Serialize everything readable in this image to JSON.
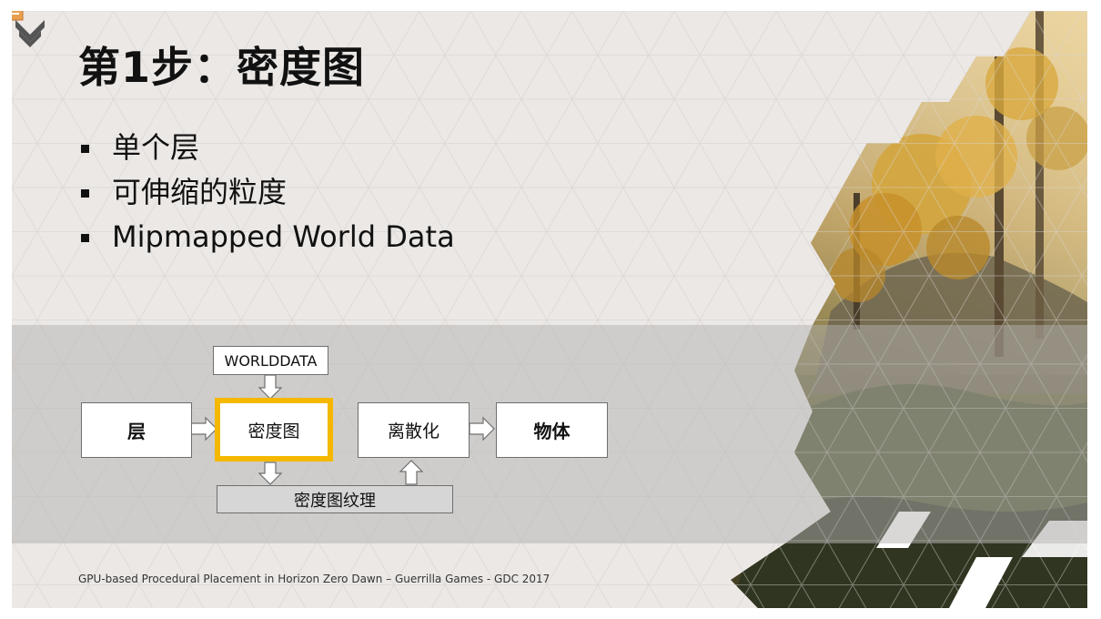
{
  "slide": {
    "title": "第1步：密度图",
    "bullets": [
      "单个层",
      "可伸缩的粒度",
      "Mipmapped World Data"
    ],
    "footer": "GPU-based Procedural Placement in Horizon Zero Dawn – Guerrilla Games - GDC 2017"
  },
  "diagram": {
    "layer": "层",
    "density_map": "密度图",
    "discretize": "离散化",
    "objects": "物体",
    "world_data": "WORLDDATA",
    "density_texture": "密度图纹理"
  },
  "colors": {
    "highlight": "#f5b800",
    "background": "#ebe8e6",
    "logo": "#e69a3c"
  },
  "icons": {
    "logo": "guerrilla-chevron-logo",
    "slide-indicator": "slide-indicator-icon"
  }
}
